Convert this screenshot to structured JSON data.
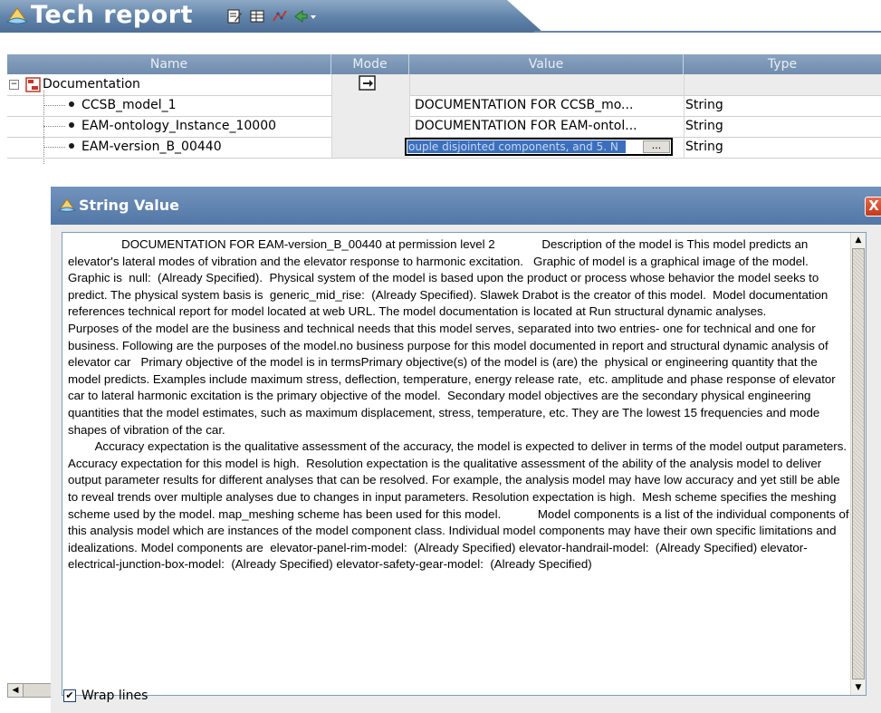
{
  "app": {
    "title": "Tech report"
  },
  "table": {
    "headers": [
      "Name",
      "Mode",
      "Value",
      "Type"
    ],
    "group": {
      "label": "Documentation",
      "expander": "⊟"
    },
    "rows": [
      {
        "name": "CCSB_model_1",
        "value": "DOCUMENTATION FOR CCSB_mo...",
        "type": "String"
      },
      {
        "name": "EAM-ontology_Instance_10000",
        "value": "DOCUMENTATION FOR EAM-ontol...",
        "type": "String"
      },
      {
        "name": "EAM-version_B_00440",
        "value": "ouple disjointed components, and 5. N",
        "type": "String",
        "editor_button": "..."
      }
    ]
  },
  "dialog": {
    "title": "String Value",
    "close": "X",
    "wrap_label": "Wrap lines",
    "wrap_checked": true,
    "text": "                DOCUMENTATION FOR EAM-version_B_00440 at permission level 2              Description of the model is This model predicts an elevator's lateral modes of vibration and the elevator response to harmonic excitation.   Graphic of model is a graphical image of the model. Graphic is  null:  (Already Specified).  Physical system of the model is based upon the product or process whose behavior the model seeks to predict. The physical system basis is  generic_mid_rise:  (Already Specified). Slawek Drabot is the creator of this model.  Model documentation references technical report for model located at web URL. The model documentation is located at Run structural dynamic analyses.           Purposes of the model are the business and technical needs that this model serves, separated into two entries- one for technical and one for business. Following are the purposes of the model.no business purpose for this model documented in report and structural dynamic analysis of elevator car   Primary objective of the model is in termsPrimary objective(s) of the model is (are) the  physical or engineering quantity that the model predicts. Examples include maximum stress, deflection, temperature, energy release rate,  etc. amplitude and phase response of elevator car to lateral harmonic excitation is the primary objective of the model.  Secondary model objectives are the secondary physical engineering quantities that the model estimates, such as maximum displacement, stress, temperature, etc. They are The lowest 15 frequencies and mode shapes of vibration of the car.\n        Accuracy expectation is the qualitative assessment of the accuracy, the model is expected to deliver in terms of the model output parameters. Accuracy expectation for this model is high.  Resolution expectation is the qualitative assessment of the ability of the analysis model to deliver output parameter results for different analyses that can be resolved. For example, the analysis model may have low accuracy and yet still be able to reveal trends over multiple analyses due to changes in input parameters. Resolution expectation is high.  Mesh scheme specifies the meshing scheme used by the model. map_meshing scheme has been used for this model.           Model components is a list of the individual components of this analysis model which are instances of the model component class. Individual model components may have their own specific limitations and idealizations. Model components are  elevator-panel-rim-model:  (Already Specified) elevator-handrail-model:  (Already Specified) elevator-electrical-junction-box-model:  (Already Specified) elevator-safety-gear-model:  (Already Specified)"
  },
  "icons": {
    "logo": "app-logo-icon",
    "toolbar": [
      "edit-icon",
      "table-icon",
      "chart-icon",
      "export-icon"
    ]
  }
}
